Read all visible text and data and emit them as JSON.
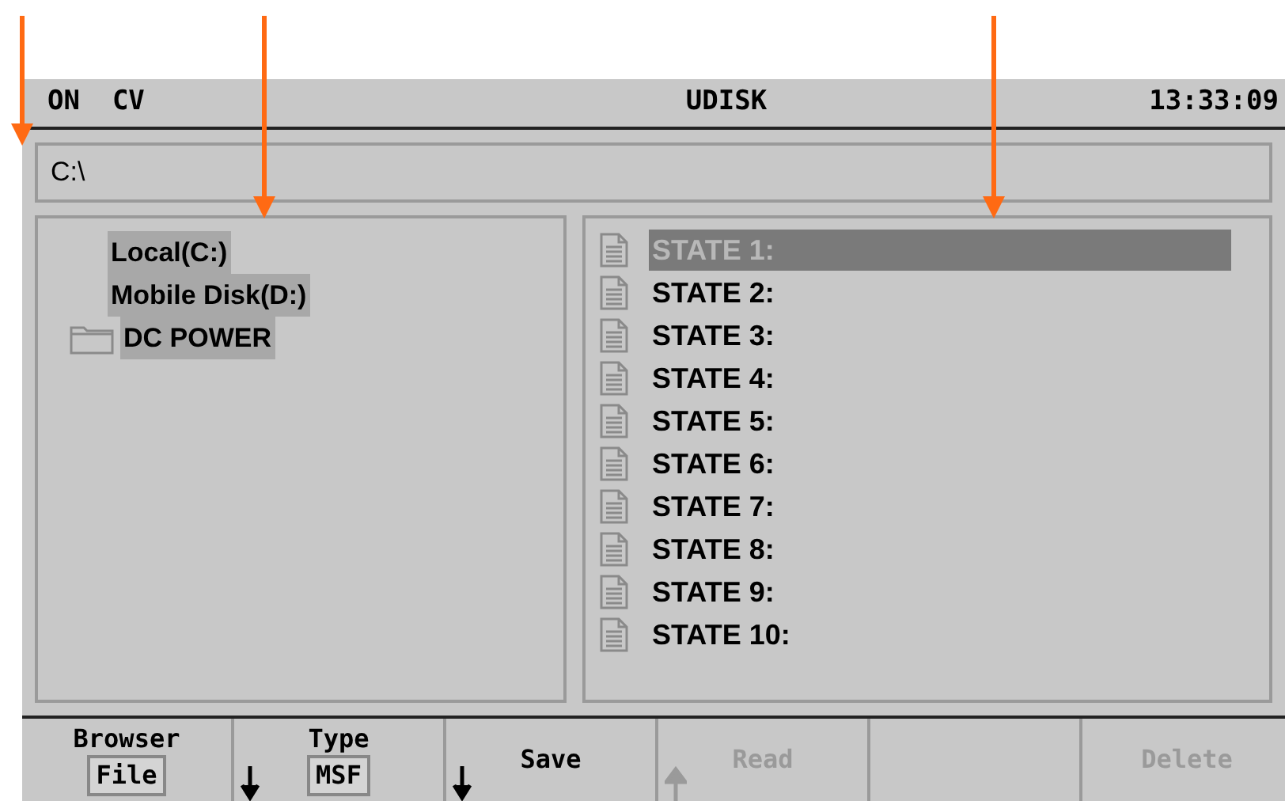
{
  "status_bar": {
    "mode": "ON  CV",
    "storage": "UDISK",
    "time": "13:33:09"
  },
  "path": {
    "value": "C:\\"
  },
  "tree": {
    "items": [
      {
        "label": "Local(C:)",
        "kind": "drive"
      },
      {
        "label": "Mobile Disk(D:)",
        "kind": "drive"
      },
      {
        "label": "DC POWER",
        "kind": "folder"
      }
    ]
  },
  "files": {
    "items": [
      {
        "label": "STATE 1:",
        "selected": true
      },
      {
        "label": "STATE 2:",
        "selected": false
      },
      {
        "label": "STATE 3:",
        "selected": false
      },
      {
        "label": "STATE 4:",
        "selected": false
      },
      {
        "label": "STATE 5:",
        "selected": false
      },
      {
        "label": "STATE 6:",
        "selected": false
      },
      {
        "label": "STATE 7:",
        "selected": false
      },
      {
        "label": "STATE 8:",
        "selected": false
      },
      {
        "label": "STATE 9:",
        "selected": false
      },
      {
        "label": "STATE 10:",
        "selected": false
      }
    ]
  },
  "softkeys": [
    {
      "label": "Browser",
      "value": "File",
      "kind": "plain",
      "disabled": false
    },
    {
      "label": "Type",
      "value": "MSF",
      "kind": "down",
      "disabled": false
    },
    {
      "label": "Save",
      "kind": "down",
      "disabled": false
    },
    {
      "label": "Read",
      "kind": "up",
      "disabled": true
    },
    {
      "kind": "plain"
    },
    {
      "label": "Delete",
      "kind": "plain",
      "disabled": true
    }
  ]
}
